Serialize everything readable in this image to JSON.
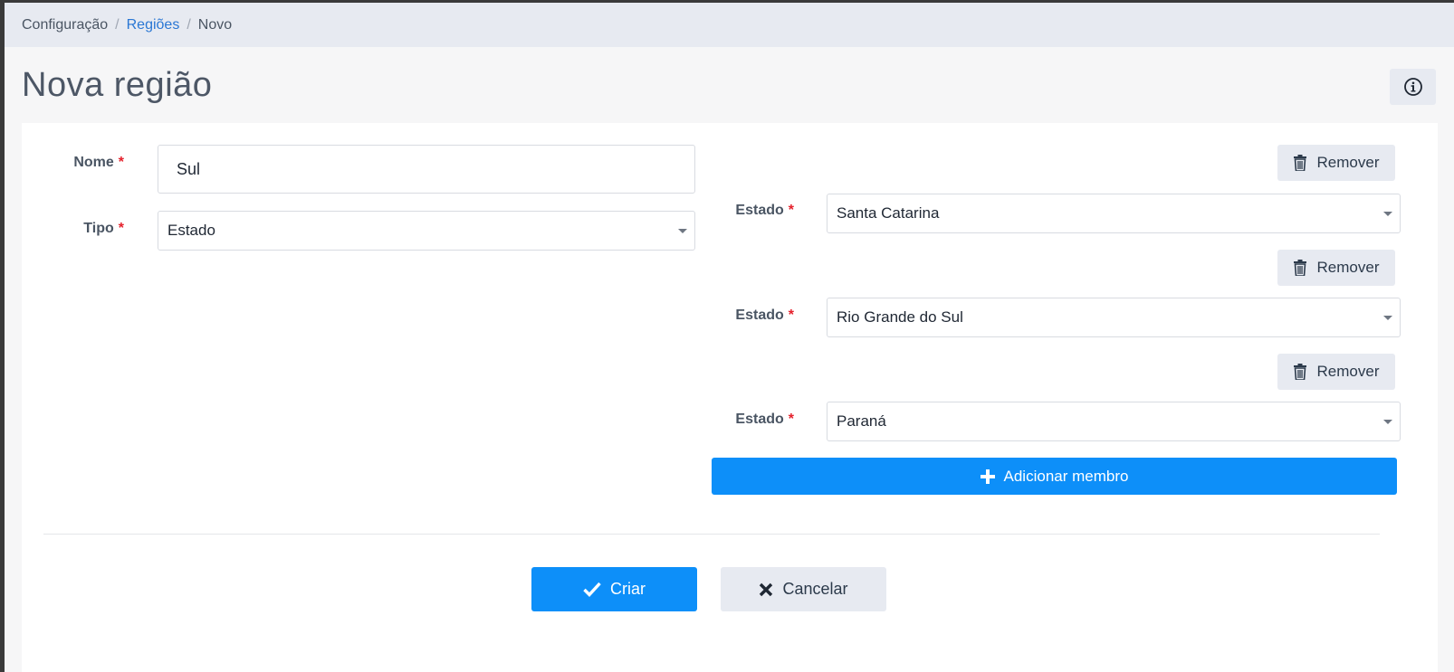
{
  "breadcrumb": {
    "items": [
      "Configuração",
      "Regiões",
      "Novo"
    ],
    "separator": "/"
  },
  "page": {
    "title": "Nova região",
    "info_icon": "info-circle-icon"
  },
  "form": {
    "nome": {
      "label": "Nome",
      "required_mark": "*",
      "value": "Sul"
    },
    "tipo": {
      "label": "Tipo",
      "required_mark": "*",
      "value": "Estado"
    }
  },
  "members": [
    {
      "remove_label": "Remover",
      "label": "Estado",
      "required_mark": "*",
      "value": "Santa Catarina"
    },
    {
      "remove_label": "Remover",
      "label": "Estado",
      "required_mark": "*",
      "value": "Rio Grande do Sul"
    },
    {
      "remove_label": "Remover",
      "label": "Estado",
      "required_mark": "*",
      "value": "Paraná"
    }
  ],
  "actions": {
    "add_member_label": "Adicionar membro",
    "create_label": "Criar",
    "cancel_label": "Cancelar"
  },
  "colors": {
    "primary": "#0d8ff9",
    "secondary": "#e7eaf1",
    "required": "#e5202b",
    "link": "#2a77d4"
  }
}
